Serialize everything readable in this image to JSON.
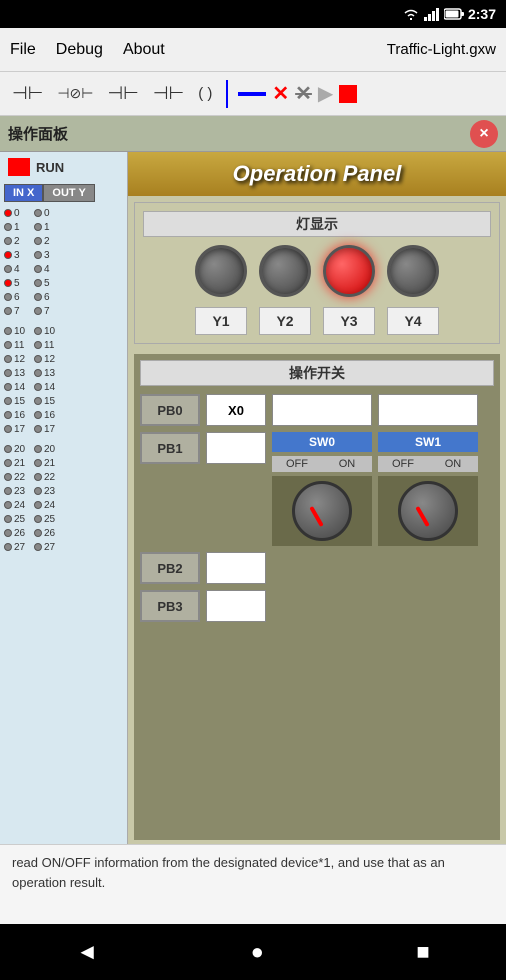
{
  "statusBar": {
    "time": "2:37",
    "icons": [
      "wifi",
      "signal",
      "battery"
    ]
  },
  "menuBar": {
    "items": [
      "File",
      "Debug",
      "About"
    ],
    "title": "Traffic-Light.gxw"
  },
  "toolbar": {
    "icons": [
      "contact",
      "contact2",
      "contact3",
      "contact4",
      "coil",
      "divider",
      "line",
      "xmark",
      "xmark2",
      "play",
      "stop"
    ]
  },
  "dialog": {
    "title": "操作面板",
    "closeIcon": "×"
  },
  "leftPanel": {
    "runLabel": "RUN",
    "inLabel": "IN X",
    "outLabel": "OUT Y",
    "rows0": [
      {
        "num": "0",
        "red": true
      },
      {
        "num": "1",
        "red": false
      },
      {
        "num": "2",
        "red": false
      },
      {
        "num": "3",
        "red": true
      },
      {
        "num": "4",
        "red": false
      },
      {
        "num": "5",
        "red": true
      },
      {
        "num": "6",
        "red": false
      },
      {
        "num": "7",
        "red": false
      }
    ],
    "rows1": [
      {
        "num": "10",
        "red": false
      },
      {
        "num": "11",
        "red": false
      },
      {
        "num": "12",
        "red": false
      },
      {
        "num": "13",
        "red": false
      },
      {
        "num": "14",
        "red": false
      },
      {
        "num": "15",
        "red": false
      },
      {
        "num": "16",
        "red": false
      },
      {
        "num": "17",
        "red": false
      }
    ],
    "rows2": [
      {
        "num": "20",
        "red": false
      },
      {
        "num": "21",
        "red": false
      },
      {
        "num": "22",
        "red": false
      },
      {
        "num": "23",
        "red": false
      },
      {
        "num": "24",
        "red": false
      },
      {
        "num": "25",
        "red": false
      },
      {
        "num": "26",
        "red": false
      },
      {
        "num": "27",
        "red": false
      }
    ]
  },
  "opPanel": {
    "headerText": "Operation Panel",
    "lightSection": {
      "title": "灯显示",
      "lights": [
        {
          "id": "L1",
          "on": false
        },
        {
          "id": "L2",
          "on": false
        },
        {
          "id": "L3",
          "on": true
        },
        {
          "id": "L4",
          "on": false
        }
      ],
      "labels": [
        "Y1",
        "Y2",
        "Y3",
        "Y4"
      ]
    },
    "switchSection": {
      "title": "操作开关",
      "buttons": [
        "PB0",
        "PB1",
        "PB2",
        "PB3"
      ],
      "xLabel": "X0",
      "sw0Label": "SW0",
      "sw1Label": "SW1",
      "offLabel": "OFF",
      "onLabel": "ON"
    }
  },
  "bottomText": "read ON/OFF information from the designated device*1, and use that as an operation result.",
  "navBar": {
    "back": "◄",
    "home": "●",
    "recent": "■"
  }
}
